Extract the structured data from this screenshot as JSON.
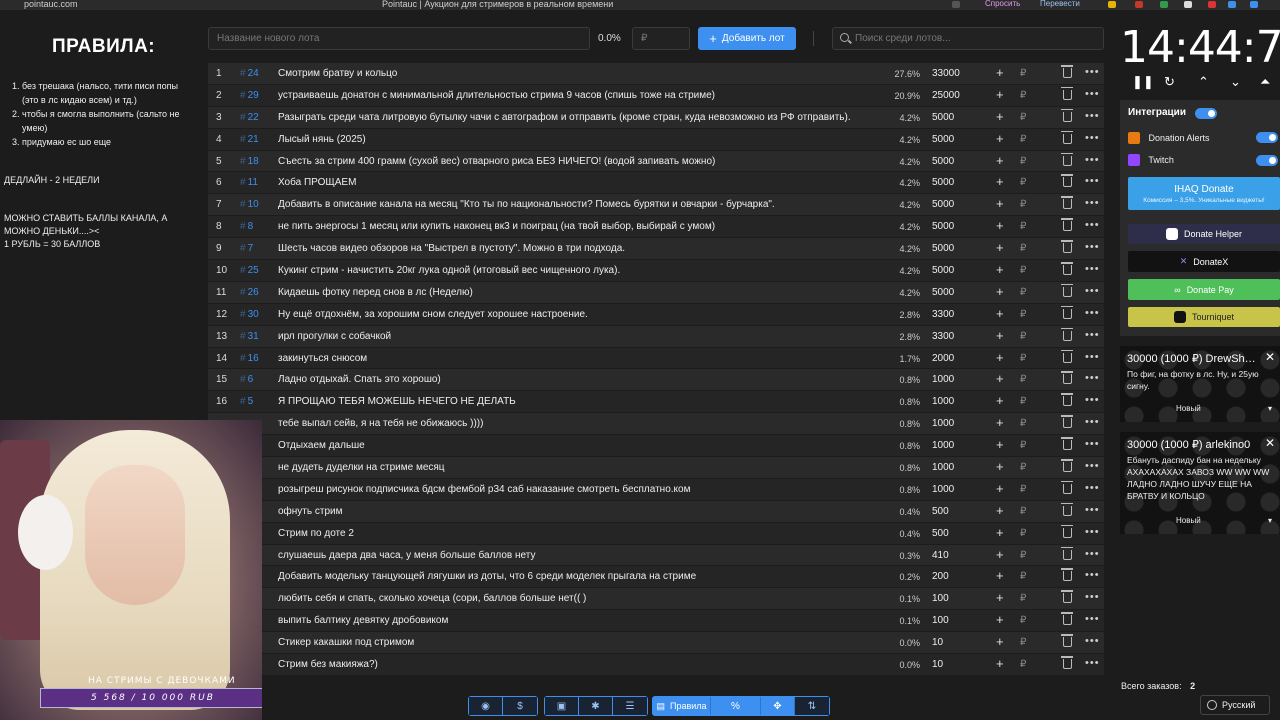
{
  "browser": {
    "url": "pointauc.com",
    "title": "Pointauc | Аукцион для стримеров в реальном времени",
    "ext_ask": "Спросить",
    "ext_translate": "Перевести"
  },
  "rules": {
    "title": "ПРАВИЛА:",
    "items": [
      "без трешака (нальсо, тити писи попы (это в лс кидаю всем) и тд.)",
      "чтобы я смогла выполнить (сальто не умею)",
      "придумаю ес шо еще"
    ],
    "deadline": "ДЕДЛАЙН - 2 НЕДЕЛИ",
    "points_line1": "МОЖНО СТАВИТЬ БАЛЛЫ КАНАЛА, А МОЖНО ДЕНЬКИ....><",
    "points_line2": "1 РУБЛЬ = 30 БАЛЛОВ"
  },
  "toolbar": {
    "lot_placeholder": "Название нового лота",
    "percent": "0.0%",
    "amount_placeholder": "₽",
    "add_label": "Добавить лот",
    "search_placeholder": "Поиск среди лотов..."
  },
  "lots": [
    {
      "idx": "1",
      "id": "24",
      "name": "Смотрим братву и кольцо",
      "pct": "27.6%",
      "amount": "33000"
    },
    {
      "idx": "2",
      "id": "29",
      "name": "устраиваешь донатон с минимальной длительностью стрима 9 часов (спишь тоже на стриме)",
      "pct": "20.9%",
      "amount": "25000"
    },
    {
      "idx": "3",
      "id": "22",
      "name": "Разыграть среди чата литровую бутылку чачи с автографом и отправить (кроме стран, куда невозможно из РФ отправить).",
      "pct": "4.2%",
      "amount": "5000"
    },
    {
      "idx": "4",
      "id": "21",
      "name": "Лысый нянь (2025)",
      "pct": "4.2%",
      "amount": "5000"
    },
    {
      "idx": "5",
      "id": "18",
      "name": "Съесть за стрим 400 грамм (сухой вес) отварного риса БЕЗ НИЧЕГО! (водой запивать можно)",
      "pct": "4.2%",
      "amount": "5000"
    },
    {
      "idx": "6",
      "id": "11",
      "name": "Хоба ПРОЩАЕМ",
      "pct": "4.2%",
      "amount": "5000"
    },
    {
      "idx": "7",
      "id": "10",
      "name": "Добавить в описание канала на месяц \"Кто ты по национальности? Помесь бурятки и овчарки - бурчарка\".",
      "pct": "4.2%",
      "amount": "5000"
    },
    {
      "idx": "8",
      "id": "8",
      "name": "не пить энергосы 1 месяц или купить наконец вк3 и поиграц (на твой выбор, выбирай с умом)",
      "pct": "4.2%",
      "amount": "5000"
    },
    {
      "idx": "9",
      "id": "7",
      "name": "Шесть часов видео обзоров на \"Выстрел в пустоту\". Можно в три подхода.",
      "pct": "4.2%",
      "amount": "5000"
    },
    {
      "idx": "10",
      "id": "25",
      "name": "Кукинг стрим - начистить 20кг лука одной (итоговый вес чищенного лука).",
      "pct": "4.2%",
      "amount": "5000"
    },
    {
      "idx": "11",
      "id": "26",
      "name": "Кидаешь фотку перед снов в лс (Неделю)",
      "pct": "4.2%",
      "amount": "5000"
    },
    {
      "idx": "12",
      "id": "30",
      "name": "Ну ещё отдохнём, за хорошим сном следует хорошее настроение.",
      "pct": "2.8%",
      "amount": "3300"
    },
    {
      "idx": "13",
      "id": "31",
      "name": "ирл прогулки с собачкой",
      "pct": "2.8%",
      "amount": "3300"
    },
    {
      "idx": "14",
      "id": "16",
      "name": "закинуться снюсом",
      "pct": "1.7%",
      "amount": "2000"
    },
    {
      "idx": "15",
      "id": "6",
      "name": "Ладно отдыхай. Спать это хорошо)",
      "pct": "0.8%",
      "amount": "1000"
    },
    {
      "idx": "16",
      "id": "5",
      "name": "Я ПРОЩАЮ ТЕБЯ МОЖЕШЬ НЕЧЕГО НЕ ДЕЛАТЬ",
      "pct": "0.8%",
      "amount": "1000"
    },
    {
      "idx": "",
      "id": "",
      "name": "тебе выпал сейв, я на тебя не обижаюсь ))))",
      "pct": "0.8%",
      "amount": "1000"
    },
    {
      "idx": "",
      "id": "",
      "name": "Отдыхаем дальше",
      "pct": "0.8%",
      "amount": "1000"
    },
    {
      "idx": "",
      "id": "",
      "name": "не дудеть дуделки на стриме месяц",
      "pct": "0.8%",
      "amount": "1000"
    },
    {
      "idx": "",
      "id": "",
      "name": "розыгреш рисунок подписчика бдсм фембой р34 саб наказание смотреть бесплатно.ком",
      "pct": "0.8%",
      "amount": "1000"
    },
    {
      "idx": "",
      "id": "",
      "name": "офнуть стрим",
      "pct": "0.4%",
      "amount": "500"
    },
    {
      "idx": "",
      "id": "",
      "name": "Стрим по доте 2",
      "pct": "0.4%",
      "amount": "500"
    },
    {
      "idx": "",
      "id": "",
      "name": "слушаешь даера два часа, у меня больше баллов нету",
      "pct": "0.3%",
      "amount": "410"
    },
    {
      "idx": "",
      "id": "",
      "name": "Добавить модельку танцующей лягушки из доты, что 6 среди моделек прыгала на стриме",
      "pct": "0.2%",
      "amount": "200"
    },
    {
      "idx": "",
      "id": "",
      "name": "любить себя и спать, сколько хочеца (сори, баллов больше нет(( )",
      "pct": "0.1%",
      "amount": "100"
    },
    {
      "idx": "",
      "id": "",
      "name": "выпить балтику девятку дробовиком",
      "pct": "0.1%",
      "amount": "100"
    },
    {
      "idx": "",
      "id": "",
      "name": "Стикер какашки под стримом",
      "pct": "0.0%",
      "amount": "10"
    },
    {
      "idx": "",
      "id": "",
      "name": "Стрим без макияжа?)",
      "pct": "0.0%",
      "amount": "10"
    }
  ],
  "lot_currency": "₽",
  "webcam": {
    "caption": "НА СТРИМЫ С ДЕВОЧКАМИ",
    "goal": "5 568 / 10 000 RUB"
  },
  "bottom": {
    "rules_label": "Правила"
  },
  "timer": {
    "value": "14:44:71"
  },
  "integrations": {
    "title": "Интеграции",
    "donation_alerts": "Donation Alerts",
    "twitch": "Twitch",
    "ihaq_title": "IHAQ Donate",
    "ihaq_sub": "Комиссия – 3,5%. Уникальные виджеты!",
    "donate_helper": "Donate Helper",
    "donatex": "DonateX",
    "donate_pay": "Donate Pay",
    "tourniquet": "Tourniquet"
  },
  "donations": [
    {
      "title": "30000 (1000 ₽) DrewSh…",
      "message": "По фиг, на фотку в лс. Ну, и 25ую сигну.",
      "status": "Новый"
    },
    {
      "title": "30000 (1000 ₽) arlekino0",
      "message": "Ебануть даспиду бан на недельку АХАХАХАХАХ ЗАВОЗ WW WW WW ЛАДНО ЛАДНО ШУЧУ ЕЩЕ НА БРАТВУ И КОЛЬЦО",
      "status": "Новый"
    }
  ],
  "footer": {
    "orders_label": "Всего заказов:",
    "orders_count": "2",
    "language": "Русский"
  },
  "colors": {
    "accent": "#3d8ff0",
    "ihaq": "#3aa0e8",
    "donate_pay": "#4fbf5a",
    "tourniquet": "#c8c44a"
  }
}
